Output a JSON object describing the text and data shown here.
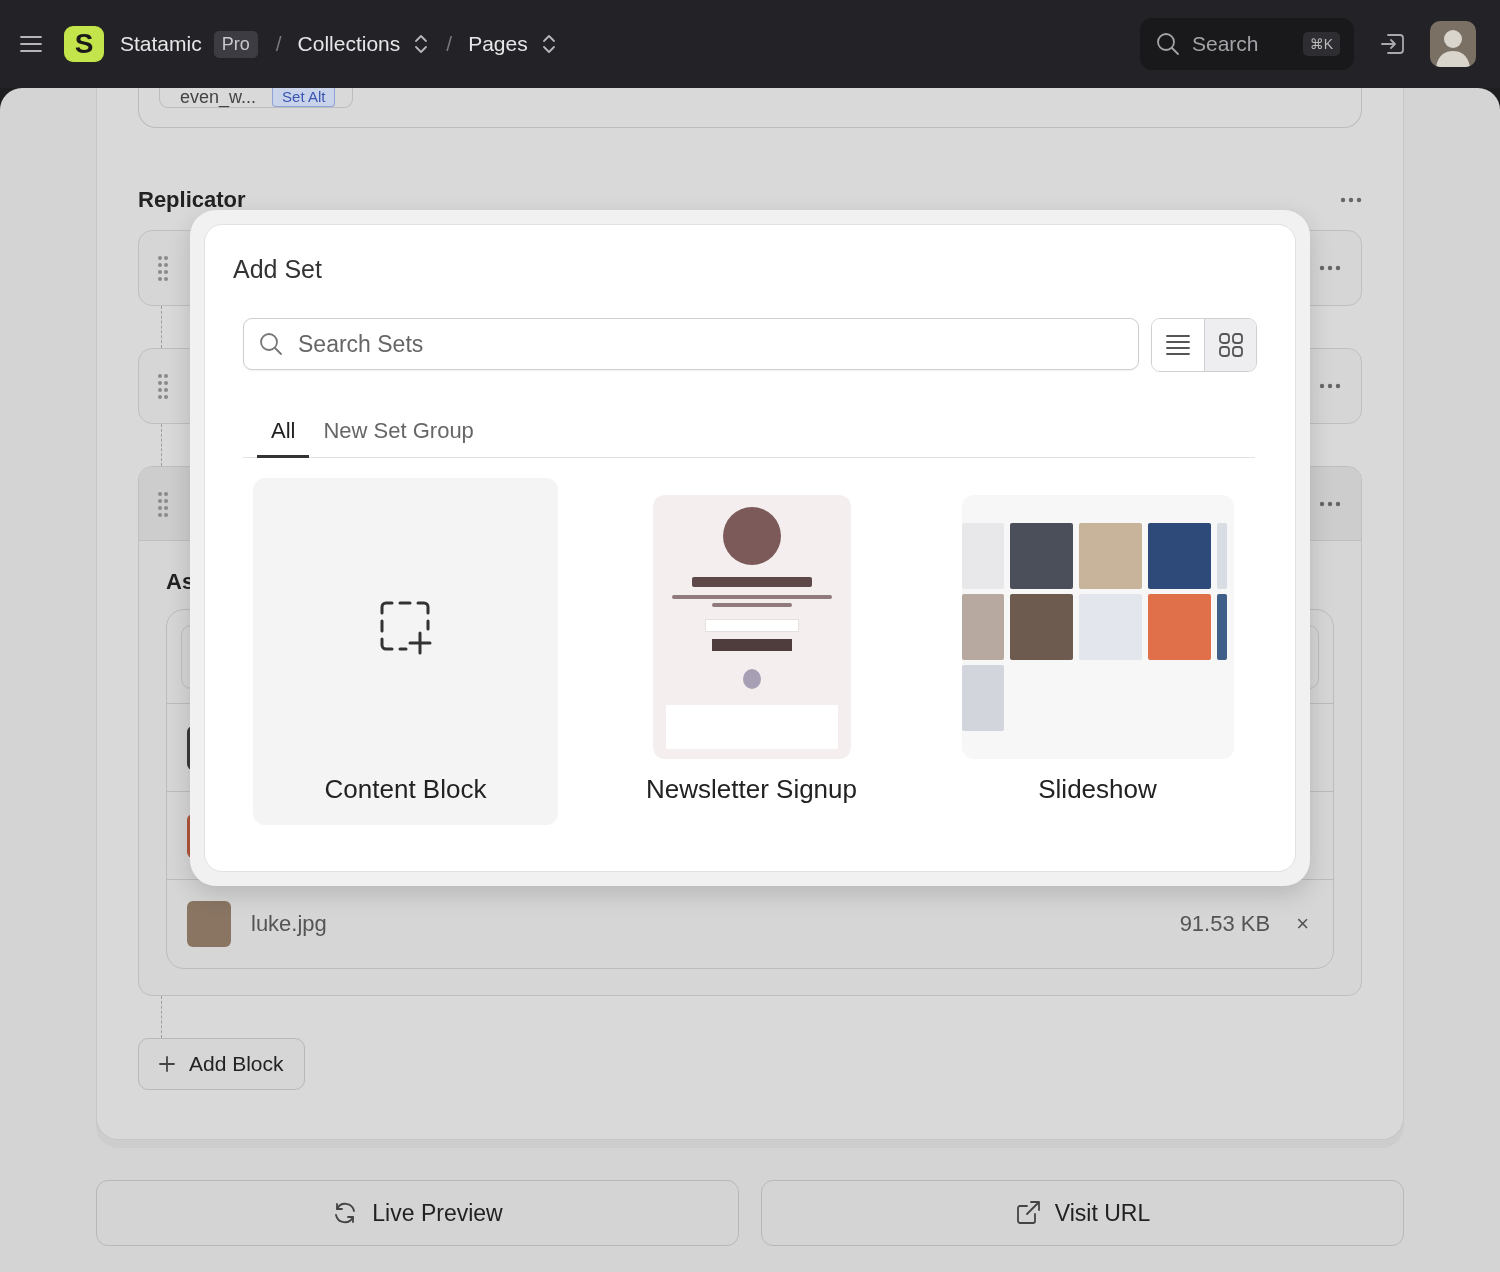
{
  "top_bar": {
    "logo_letter": "S",
    "site": "Statamic",
    "edition": "Pro",
    "breadcrumbs": [
      {
        "separator": "/",
        "label": "Collections"
      },
      {
        "separator": "/",
        "label": "Pages"
      }
    ],
    "search": {
      "placeholder": "Search",
      "shortcut": "⌘K"
    }
  },
  "page": {
    "top_field": {
      "value": "even_w...",
      "badge": "Set Alt"
    },
    "replicator": {
      "title": "Replicator",
      "sets": [
        {
          "expanded": false
        },
        {
          "expanded": false
        },
        {
          "expanded": true
        }
      ]
    },
    "assets": {
      "title": "As",
      "files": [
        {
          "name": "luke.jpg",
          "size": "91.53 KB",
          "remove": "×"
        }
      ]
    },
    "add_button": "Add Block"
  },
  "footer_buttons": [
    {
      "label": "Live Preview",
      "kind": "refresh"
    },
    {
      "label": "Visit URL",
      "kind": "external"
    }
  ],
  "modal": {
    "title": "Add Set",
    "search_placeholder": "Search Sets",
    "view_modes": [
      {
        "kind": "list",
        "selected": false
      },
      {
        "kind": "grid",
        "selected": true
      }
    ],
    "tabs": [
      {
        "label": "All",
        "selected": true
      },
      {
        "label": "New Set Group",
        "selected": false
      }
    ],
    "sets": [
      {
        "label": "Content Block",
        "kind": "icon"
      },
      {
        "label": "Newsletter Signup",
        "kind": "newsletter"
      },
      {
        "label": "Slideshow",
        "kind": "gallery"
      }
    ]
  }
}
